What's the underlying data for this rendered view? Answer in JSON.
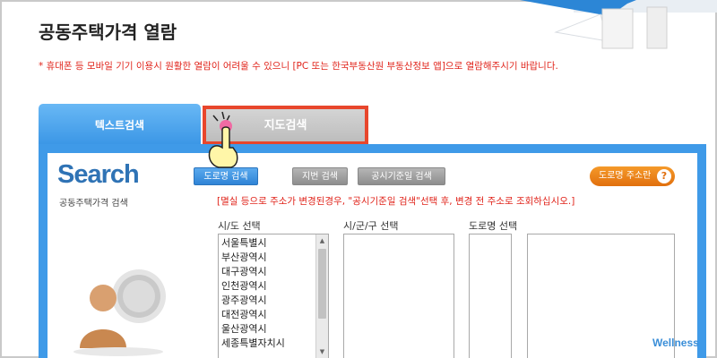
{
  "page": {
    "title": "공동주택가격 열람",
    "notice": "* 휴대폰 등 모바일 기기 이용시 원활한 열람이 어려울 수 있으니 [PC 또는 한국부동산원 부동산정보 앱]으로 열람해주시기 바랍니다."
  },
  "tabs": [
    {
      "label": "텍스트검색",
      "active": true
    },
    {
      "label": "지도검색",
      "active": false,
      "highlighted": true
    }
  ],
  "search_panel": {
    "logo": "Search",
    "subtitle": "공동주택가격 검색",
    "buttons": {
      "road": "도로명 검색",
      "lot": "지번 검색",
      "notice_date": "공시기준일 검색",
      "guide": "도로명 주소란"
    },
    "help_icon": "?",
    "warning": "[멸실 등으로 주소가 변경된경우, \"공시기준일 검색\"선택 후, 변경 전 주소로 조회하십시오.]",
    "columns": {
      "sido": "시/도 선택",
      "sigungu": "시/군/구 선택",
      "road": "도로명 선택"
    },
    "sido_options": [
      "서울특별시",
      "부산광역시",
      "대구광역시",
      "인천광역시",
      "광주광역시",
      "대전광역시",
      "울산광역시",
      "세종특별자치시"
    ]
  },
  "watermark": "Wellness",
  "colors": {
    "accent_blue": "#3f9ae8",
    "warning_red": "#e0241b",
    "highlight_border": "#e8462c",
    "guide_orange": "#f08a1c"
  },
  "icons": [
    "pointing-hand-icon",
    "user-avatar-icon",
    "help-icon",
    "scroll-up-icon",
    "scroll-down-icon"
  ]
}
